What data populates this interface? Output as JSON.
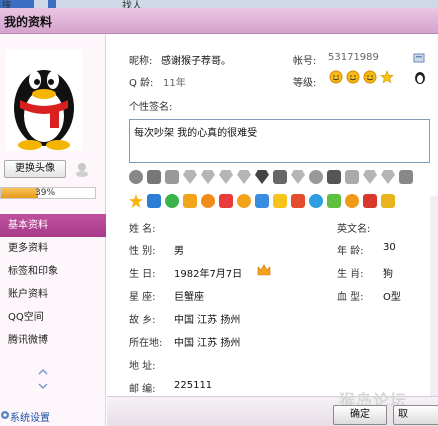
{
  "top_strip": {
    "fragment_left": "搜",
    "fragment_right": "找人"
  },
  "window": {
    "title": "我的资料"
  },
  "profile": {
    "nickname_label": "昵称:",
    "nickname": "感谢猴子荐哥。",
    "account_label": "帐号:",
    "account": "53171989",
    "qage_label": "Q 龄:",
    "qage": "11年",
    "level_label": "等级:",
    "signature_label": "个性签名:",
    "signature": "每次吵架 我的心真的很难受"
  },
  "left": {
    "change_avatar": "更换头像",
    "progress_percent": 39,
    "progress_text": "39%",
    "nav": [
      "基本资料",
      "更多资料",
      "标签和印象",
      "账户资料",
      "QQ空间",
      "腾讯微博"
    ],
    "active_index": 0,
    "settings": "系统设置"
  },
  "details": {
    "left_col": [
      {
        "label": "姓    名:",
        "value": ""
      },
      {
        "label": "性    别:",
        "value": "男"
      },
      {
        "label": "生    日:",
        "value": "1982年7月7日"
      },
      {
        "label": "星    座:",
        "value": "巨蟹座"
      },
      {
        "label": "故    乡:",
        "value": "中国  江苏  扬州"
      },
      {
        "label": "所在地:",
        "value": "中国  江苏  扬州"
      },
      {
        "label": "地    址:",
        "value": ""
      },
      {
        "label": "邮    编:",
        "value": "225111"
      }
    ],
    "right_col": [
      {
        "label": "英文名:",
        "value": ""
      },
      {
        "label": "年    龄:",
        "value": "30"
      },
      {
        "label": "生    肖:",
        "value": "狗"
      },
      {
        "label": "血    型:",
        "value": "O型"
      }
    ]
  },
  "footer": {
    "ok": "确定",
    "cancel": "取"
  },
  "watermark": "猴岛论坛",
  "colors": {
    "accent": "#a73b89",
    "title_bg": "#d5a2cd"
  }
}
